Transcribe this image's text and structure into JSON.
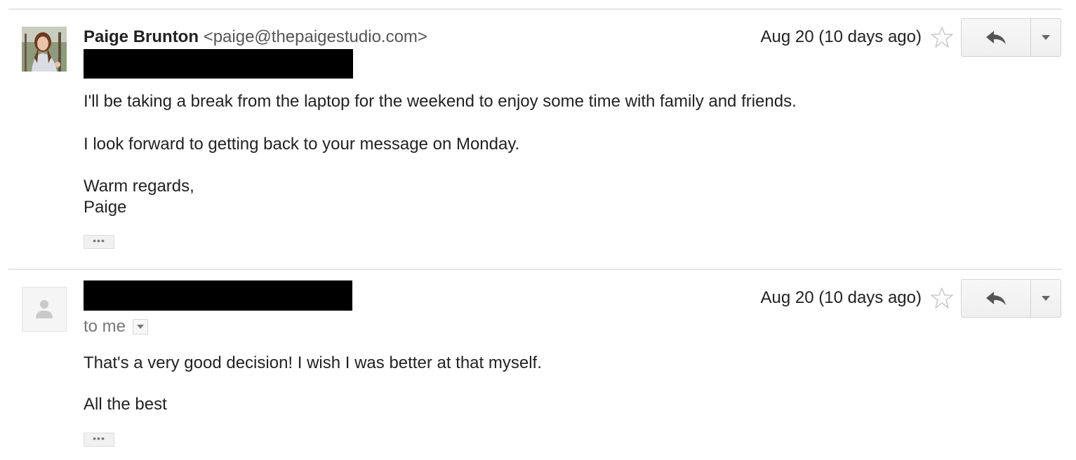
{
  "messages": [
    {
      "sender_name": "Paige Brunton",
      "sender_email": "<paige@thepaigestudio.com>",
      "date": "Aug 20 (10 days ago)",
      "body": [
        "I'll be taking a break from the laptop for the weekend to enjoy some time with family and friends.",
        "I look forward to getting back to your message on Monday.",
        "Warm regards,",
        "Paige"
      ],
      "avatar": "profile-photo",
      "icons": {
        "star": "star-icon",
        "reply": "reply-icon",
        "more": "chevron-down-icon"
      }
    },
    {
      "to_line": "to me",
      "date": "Aug 20 (10 days ago)",
      "body": [
        "That's a very good decision! I wish I was better at that myself.",
        "All the best"
      ],
      "avatar": "default-person-icon",
      "icons": {
        "star": "star-icon",
        "reply": "reply-icon",
        "more": "chevron-down-icon"
      }
    }
  ],
  "colors": {
    "divider": "#e5e5e5",
    "text": "#222222",
    "muted": "#777777",
    "redaction": "#000000"
  }
}
